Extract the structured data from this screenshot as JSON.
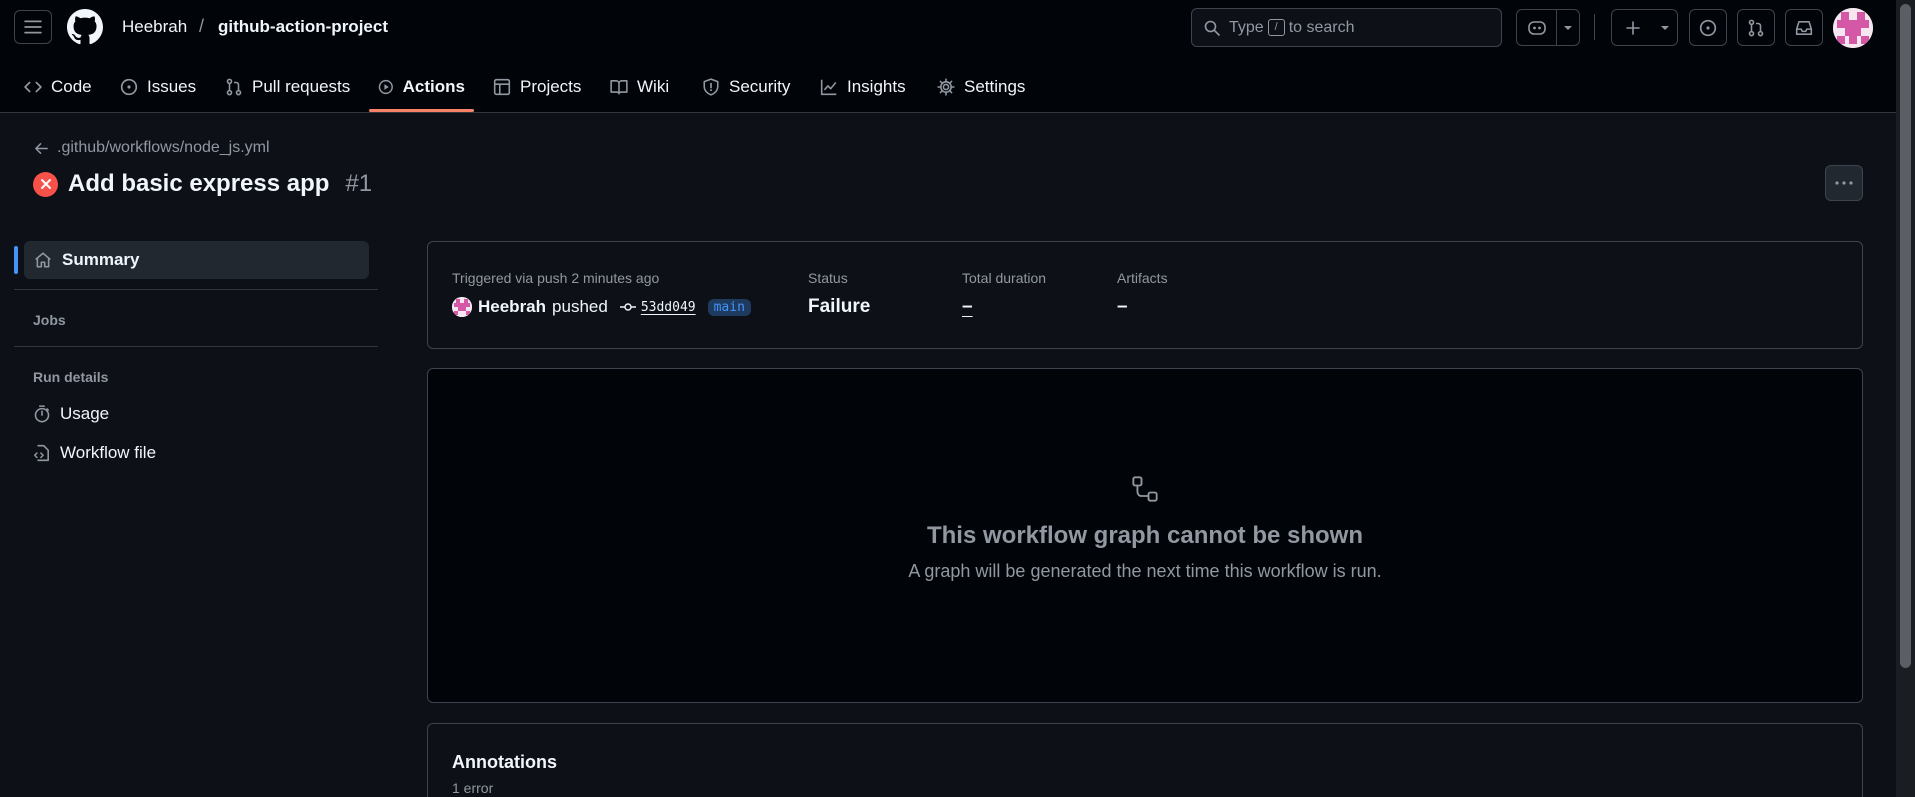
{
  "header": {
    "owner": "Heebrah",
    "separator": "/",
    "repo": "github-action-project",
    "search_prefix": "Type",
    "search_key": "/",
    "search_suffix": "to search"
  },
  "nav": {
    "tabs": [
      {
        "label": "Code",
        "icon": "code-icon"
      },
      {
        "label": "Issues",
        "icon": "issue-icon"
      },
      {
        "label": "Pull requests",
        "icon": "pull-request-icon"
      },
      {
        "label": "Actions",
        "icon": "play-icon",
        "active": true
      },
      {
        "label": "Projects",
        "icon": "table-icon"
      },
      {
        "label": "Wiki",
        "icon": "book-icon"
      },
      {
        "label": "Security",
        "icon": "shield-icon"
      },
      {
        "label": "Insights",
        "icon": "graph-icon"
      },
      {
        "label": "Settings",
        "icon": "gear-icon"
      }
    ]
  },
  "run": {
    "workflow_path": ".github/workflows/node_js.yml",
    "title": "Add basic express app",
    "number": "#1"
  },
  "sidebar": {
    "summary": "Summary",
    "jobs_heading": "Jobs",
    "run_details_heading": "Run details",
    "usage": "Usage",
    "workflow_file": "Workflow file"
  },
  "summary": {
    "trigger_text": "Triggered via push 2 minutes ago",
    "user": "Heebrah",
    "action": "pushed",
    "commit_sha": "53dd049",
    "branch": "main",
    "status_label": "Status",
    "status_value": "Failure",
    "duration_label": "Total duration",
    "duration_value": "–",
    "artifacts_label": "Artifacts",
    "artifacts_value": "–"
  },
  "graph": {
    "title": "This workflow graph cannot be shown",
    "subtitle": "A graph will be generated the next time this workflow is run."
  },
  "annotations": {
    "title": "Annotations",
    "count": "1 error"
  },
  "colors": {
    "accent_tab": "#f78166",
    "failure": "#f85149",
    "link_blue": "#4493f8"
  }
}
